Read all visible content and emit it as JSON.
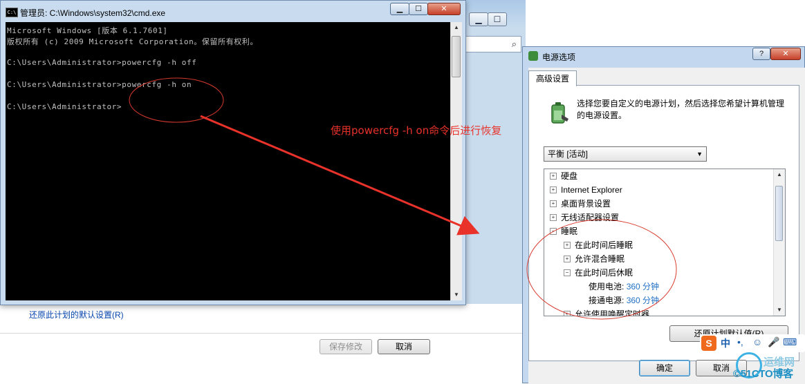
{
  "background_window": {
    "restore_link": "还原此计划的默认设置(R)",
    "save_button": "保存修改",
    "cancel_button": "取消",
    "min_glyph": "▁",
    "max_glyph": "☐",
    "search_icon": "search-icon"
  },
  "cmd_window": {
    "title": "管理员: C:\\Windows\\system32\\cmd.exe",
    "icon_text": "C:\\",
    "controls": {
      "minimize": "▁",
      "maximize": "☐",
      "close": "✕"
    },
    "lines": [
      "Microsoft Windows [版本 6.1.7601]",
      "版权所有 (c) 2009 Microsoft Corporation。保留所有权利。",
      "",
      "C:\\Users\\Administrator>powercfg -h off",
      "",
      "C:\\Users\\Administrator>powercfg -h on",
      "",
      "C:\\Users\\Administrator>"
    ]
  },
  "annotation": {
    "text": "使用powercfg -h on命令后进行恢复",
    "color": "#e8322a"
  },
  "power_options": {
    "title": "电源选项",
    "help_glyph": "?",
    "close_glyph": "✕",
    "tab": "高级设置",
    "description": "选择您要自定义的电源计划，然后选择您希望计算机管理的电源设置。",
    "plan_select": "平衡 [活动]",
    "tree": [
      {
        "label": "硬盘",
        "indent": 0,
        "expander": "+"
      },
      {
        "label": "Internet Explorer",
        "indent": 0,
        "expander": "+"
      },
      {
        "label": "桌面背景设置",
        "indent": 0,
        "expander": "+"
      },
      {
        "label": "无线适配器设置",
        "indent": 0,
        "expander": "+"
      },
      {
        "label": "睡眠",
        "indent": 0,
        "expander": "−"
      },
      {
        "label": "在此时间后睡眠",
        "indent": 1,
        "expander": "+"
      },
      {
        "label": "允许混合睡眠",
        "indent": 1,
        "expander": "+"
      },
      {
        "label": "在此时间后休眠",
        "indent": 1,
        "expander": "−"
      },
      {
        "label": "使用电池:",
        "indent": 2,
        "value": "360 分钟"
      },
      {
        "label": "接通电源:",
        "indent": 2,
        "value": "360 分钟"
      },
      {
        "label": "允许使用唤醒定时器",
        "indent": 1,
        "expander": "+"
      }
    ],
    "restore_defaults_button": "还原计划默认值(R)",
    "ok_button": "确定",
    "cancel_button": "取消"
  },
  "ime_toolbar": {
    "logo": "S",
    "mode": "中",
    "punct": "•,",
    "emoji": "☺",
    "voice": "🎤",
    "keyboard": "⌨"
  },
  "watermark": {
    "line1": "运维网",
    "line2": "©51CTO博客"
  }
}
